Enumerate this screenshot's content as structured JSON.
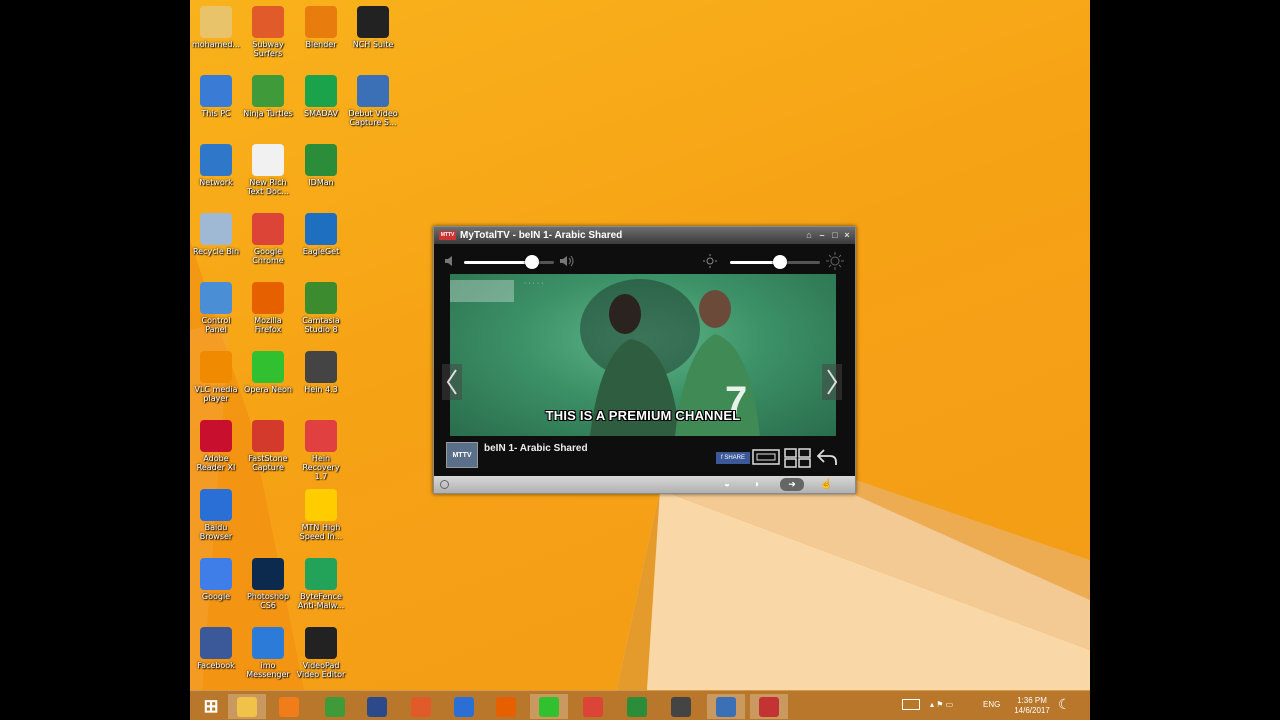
{
  "desktop_icons": [
    {
      "label": "mohamed...",
      "icon": "user-folder-icon",
      "color": "#e8c36a"
    },
    {
      "label": "Subway Surfers",
      "icon": "subway-surfers-icon",
      "color": "#e05a2a"
    },
    {
      "label": "Blender",
      "icon": "blender-icon",
      "color": "#e87d0d"
    },
    {
      "label": "NCH Suite",
      "icon": "nch-suite-icon",
      "color": "#222222"
    },
    {
      "label": "This PC",
      "icon": "this-pc-icon",
      "color": "#3a7bd5"
    },
    {
      "label": "Ninja Turtles",
      "icon": "ninja-turtles-icon",
      "color": "#3f9b3a"
    },
    {
      "label": "SMADAV",
      "icon": "smadav-icon",
      "color": "#1aa34a"
    },
    {
      "label": "Debut Video Capture S...",
      "icon": "debut-video-icon",
      "color": "#3b6fb6"
    },
    {
      "label": "Network",
      "icon": "network-icon",
      "color": "#2f77c9"
    },
    {
      "label": "New Rich Text Doc...",
      "icon": "document-icon",
      "color": "#f1f1f1"
    },
    {
      "label": "IDMan",
      "icon": "idm-icon",
      "color": "#2b8c3a"
    },
    {
      "label": "Recycle Bin",
      "icon": "recycle-bin-icon",
      "color": "#9fb9d4"
    },
    {
      "label": "Google Chrome",
      "icon": "chrome-icon",
      "color": "#db4437"
    },
    {
      "label": "EagleGet",
      "icon": "eagleget-icon",
      "color": "#1e6fc0"
    },
    {
      "label": "Control Panel",
      "icon": "control-panel-icon",
      "color": "#4a8fd6"
    },
    {
      "label": "Mozilla Firefox",
      "icon": "firefox-icon",
      "color": "#e66000"
    },
    {
      "label": "Camtasia Studio 8",
      "icon": "camtasia-icon",
      "color": "#3c8b2e"
    },
    {
      "label": "VLC media player",
      "icon": "vlc-icon",
      "color": "#f08a00"
    },
    {
      "label": "Opera Neon",
      "icon": "opera-neon-icon",
      "color": "#30c030"
    },
    {
      "label": "Hein 4.3",
      "icon": "hein-icon",
      "color": "#444444"
    },
    {
      "label": "Adobe Reader XI",
      "icon": "adobe-reader-icon",
      "color": "#c8102e"
    },
    {
      "label": "FastStone Capture",
      "icon": "faststone-icon",
      "color": "#d33a2c"
    },
    {
      "label": "Hein Recovery 1.7",
      "icon": "hein-recovery-icon",
      "color": "#e04040"
    },
    {
      "label": "Baidu Browser",
      "icon": "baidu-browser-icon",
      "color": "#2a6fd6"
    },
    {
      "label": "MTN High Speed In...",
      "icon": "mtn-icon",
      "color": "#ffcc00"
    },
    {
      "label": "Google",
      "icon": "google-icon",
      "color": "#3f7de8"
    },
    {
      "label": "Photoshop CS6",
      "icon": "photoshop-icon",
      "color": "#0c2a4e"
    },
    {
      "label": "ByteFence Anti-Malw...",
      "icon": "bytefence-icon",
      "color": "#23a25a"
    },
    {
      "label": "Facebook",
      "icon": "facebook-icon",
      "color": "#3b5998"
    },
    {
      "label": "imo Messenger",
      "icon": "imo-icon",
      "color": "#2c7bd8"
    },
    {
      "label": "VideoPad Video Editor",
      "icon": "videopad-icon",
      "color": "#222222"
    }
  ],
  "player": {
    "title": "MyTotalTV - beIN 1- Arabic Shared",
    "channel_name": "beIN 1- Arabic Shared",
    "subtitle": "THIS IS A PREMIUM CHANNEL",
    "logo_text": "MTTV",
    "volume_level": 0.75,
    "brightness_level": 0.55,
    "share_label": "SHARE"
  },
  "taskbar": {
    "items": [
      {
        "icon": "start-icon",
        "color": "#ffffff"
      },
      {
        "icon": "file-explorer-icon",
        "color": "#f0c24a"
      },
      {
        "icon": "media-player-icon",
        "color": "#f07d1a"
      },
      {
        "icon": "ninja-turtles-icon",
        "color": "#3f9b3a"
      },
      {
        "icon": "game-icon",
        "color": "#2c4a8a"
      },
      {
        "icon": "subway-surfers-icon",
        "color": "#e05a2a"
      },
      {
        "icon": "baidu-browser-icon",
        "color": "#2a6fd6"
      },
      {
        "icon": "firefox-icon",
        "color": "#e66000"
      },
      {
        "icon": "opera-neon-icon",
        "color": "#30c030"
      },
      {
        "icon": "chrome-icon",
        "color": "#db4437"
      },
      {
        "icon": "idm-icon",
        "color": "#2b8c3a"
      },
      {
        "icon": "hein-icon",
        "color": "#444444"
      },
      {
        "icon": "debut-video-icon",
        "color": "#3b6fb6"
      },
      {
        "icon": "mytotaltv-icon",
        "color": "#c33333"
      }
    ],
    "language": "ENG",
    "time": "1:36 PM",
    "date": "14/6/2017"
  }
}
